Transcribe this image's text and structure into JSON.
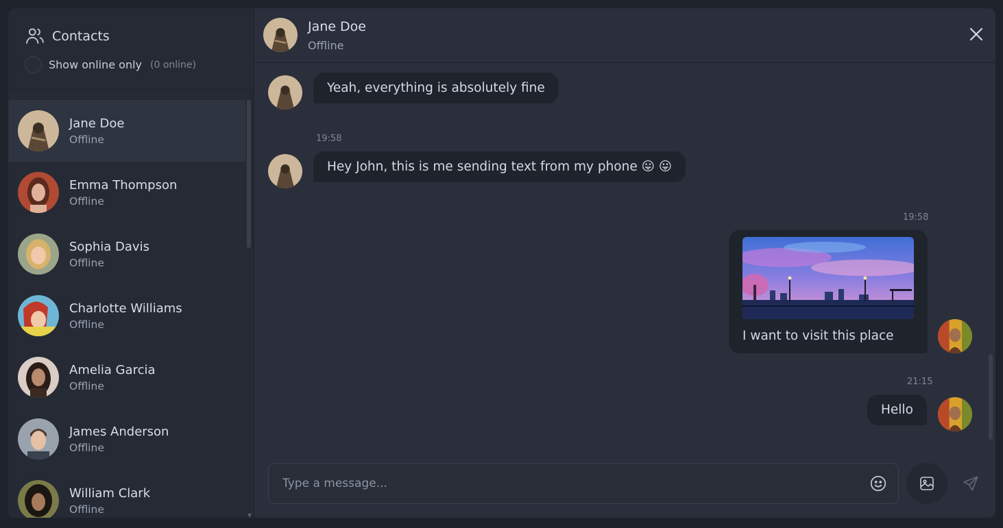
{
  "sidebar": {
    "title": "Contacts",
    "filter_label": "Show online only",
    "online_count": "(0 online)",
    "contacts": [
      {
        "name": "Jane Doe",
        "status": "Offline",
        "avatar_color": "#8b6a4a"
      },
      {
        "name": "Emma Thompson",
        "status": "Offline",
        "avatar_color": "#a0452f"
      },
      {
        "name": "Sophia Davis",
        "status": "Offline",
        "avatar_color": "#c7a76b"
      },
      {
        "name": "Charlotte Williams",
        "status": "Offline",
        "avatar_color": "#4fa3c9"
      },
      {
        "name": "Amelia Garcia",
        "status": "Offline",
        "avatar_color": "#6b4a3c"
      },
      {
        "name": "James Anderson",
        "status": "Offline",
        "avatar_color": "#7d8590"
      },
      {
        "name": "William Clark",
        "status": "Offline",
        "avatar_color": "#3b3a2e"
      }
    ]
  },
  "chat": {
    "contact_name": "Jane Doe",
    "contact_status": "Offline",
    "messages": [
      {
        "text": "Yeah, everything is absolutely fine",
        "direction": "incoming"
      },
      {
        "time": "19:58",
        "text": "Hey John, this is me sending text from my phone 😛 😛",
        "direction": "incoming"
      },
      {
        "time": "19:58",
        "text": "I want to visit this place",
        "direction": "outgoing",
        "has_image": true
      },
      {
        "time": "21:15",
        "text": "Hello",
        "direction": "outgoing"
      }
    ]
  },
  "composer": {
    "placeholder": "Type a message..."
  },
  "icons": {
    "contacts": "users-icon",
    "close": "close-icon",
    "emoji": "smiley-icon",
    "image": "image-icon",
    "send": "send-icon"
  },
  "colors": {
    "background": "#1e222b",
    "panel": "#2a2f3b",
    "sidebar": "#252a35",
    "bubble": "#1f232c",
    "active_contact": "#2e3440"
  }
}
